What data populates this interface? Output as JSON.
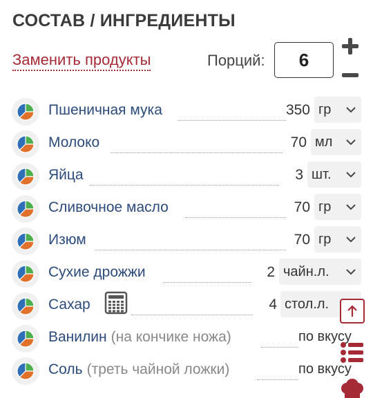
{
  "header": {
    "title": "СОСТАВ / ИНГРЕДИЕНТЫ"
  },
  "controls": {
    "replace_link": "Заменить продукты",
    "portions_label": "Порций:",
    "portions_value": "6"
  },
  "ingredients": [
    {
      "name": "Пшеничная мука",
      "note": "",
      "qty": "350",
      "unit": "гр",
      "has_select": true
    },
    {
      "name": "Молоко",
      "note": "",
      "qty": "70",
      "unit": "мл",
      "has_select": true
    },
    {
      "name": "Яйца",
      "note": "",
      "qty": "3",
      "unit": "шт.",
      "has_select": true
    },
    {
      "name": "Сливочное масло",
      "note": "",
      "qty": "70",
      "unit": "гр",
      "has_select": true
    },
    {
      "name": "Изюм",
      "note": "",
      "qty": "70",
      "unit": "гр",
      "has_select": true
    },
    {
      "name": "Сухие дрожжи",
      "note": "",
      "qty": "2",
      "unit": "чайн.л.",
      "has_select": true
    },
    {
      "name": "Сахар",
      "note": "",
      "qty": "4",
      "unit": "стол.л.",
      "has_select": true
    },
    {
      "name": "Ванилин",
      "note": "(на кончике ножа)",
      "qty": "",
      "unit": "по вкусу",
      "has_select": false
    },
    {
      "name": "Соль",
      "note": "(треть чайной ложки)",
      "qty": "",
      "unit": "по вкусу",
      "has_select": false
    }
  ],
  "icons": {
    "pie": "pie-chart-icon",
    "calculator": "calculator-icon",
    "chevron": "chevron-down-icon",
    "plus": "plus-icon",
    "minus": "minus-icon",
    "scroll_up": "arrow-up-icon",
    "list": "list-icon",
    "chef": "chef-hat-icon"
  },
  "colors": {
    "accent": "#a52a36",
    "ingredient_text": "#2c4a7a",
    "pie_blue": "#2f6fb7",
    "pie_orange": "#e0702a",
    "pie_green": "#4cae4c"
  }
}
